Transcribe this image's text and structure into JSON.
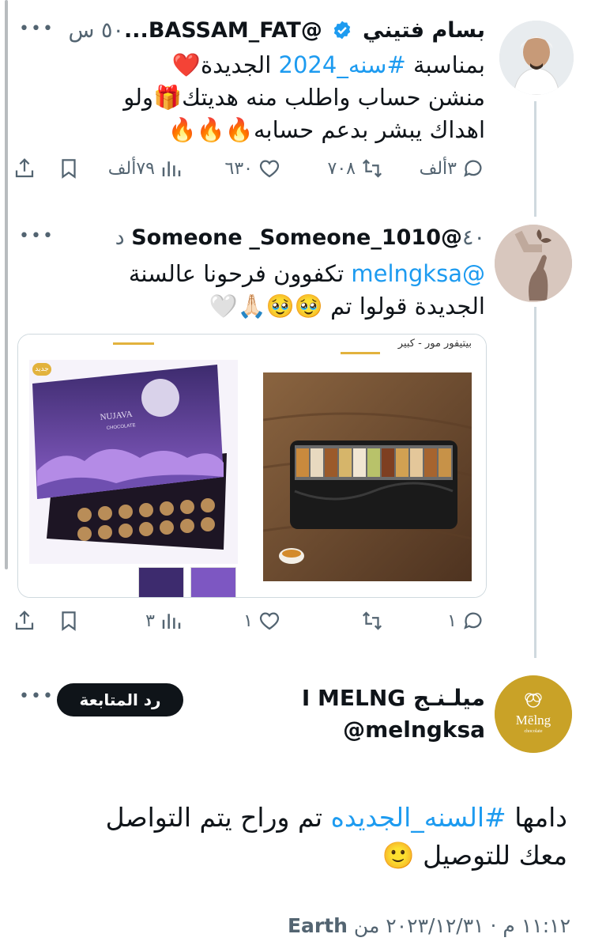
{
  "tweet1": {
    "name": "بسام فتيني",
    "handle": "@BASSAM_FAT...",
    "time": "٥٠ س",
    "line1_pre": "بمناسبة ",
    "line1_tag": "#سنه_2024",
    "line1_post": " الجديدة❤️",
    "line2": "منشن حساب واطلب منه هديتك🎁ولو",
    "line3": "اهداك يبشر بدعم حسابه🔥🔥🔥",
    "replies": "٣ألف",
    "retweets": "٧٠٨",
    "likes": "٦٣٠",
    "views": "٧٩ألف"
  },
  "tweet2": {
    "name": "Someone",
    "handle": "_Someone_1010@",
    "time": "٤٠ د",
    "mention": "@melngksa",
    "line1_post": " تكفوون فرحونا عالسنة",
    "line2": "الجديدة قولوا تم 🥹🥹🙏🏻🤍",
    "product_right_label": "بيتيفور مور - كبير",
    "product_left_badge": "جديد",
    "box_brand": "NUJAVA",
    "box_sub": "CHOCOLATE",
    "replies": "١",
    "likes": "١",
    "views": "٣"
  },
  "tweet3": {
    "name": "ميلـنـج I MELNG",
    "handle": "@melngksa",
    "logo_text": "Mēlng",
    "logo_sub": "chocolate",
    "follow_label": "رد المتابعة",
    "text_pre": "دامها ",
    "text_tag": "#السنه_الجديده",
    "text_post": " تم وراح يتم التواصل",
    "text_line2": "معك للتوصيل 🙂",
    "meta_time": "١١:١٢ م",
    "meta_sep": " · ",
    "meta_date": "٢٠٢٣/١٢/٣١",
    "meta_from": " من ",
    "meta_source": "Earth"
  },
  "colors": {
    "accent": "#1d9bf0",
    "text": "#0f1419",
    "muted": "#536471",
    "logo_bg": "#c9a227"
  }
}
